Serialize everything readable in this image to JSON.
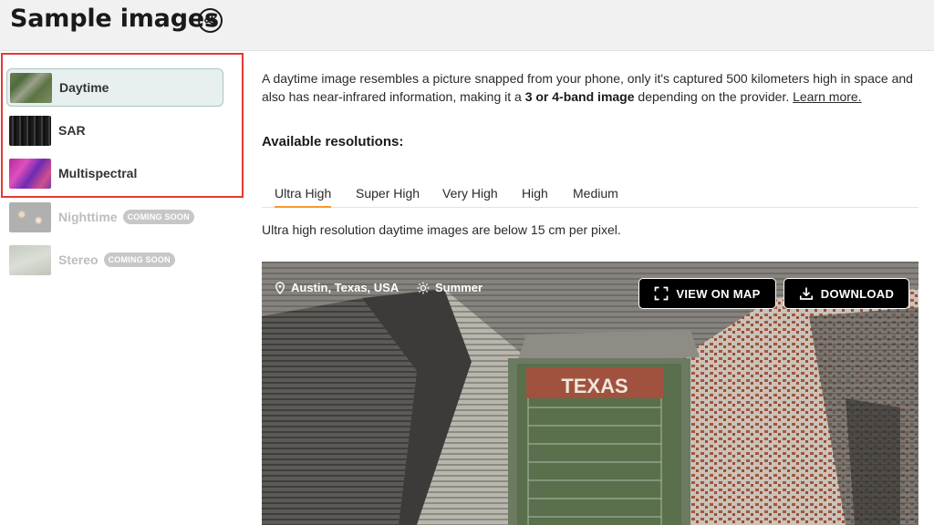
{
  "header": {
    "title": "Sample images",
    "share_icon": "share-icon"
  },
  "sidebar": {
    "items": [
      {
        "label": "Daytime",
        "badge": ""
      },
      {
        "label": "SAR",
        "badge": ""
      },
      {
        "label": "Multispectral",
        "badge": ""
      },
      {
        "label": "Nighttime",
        "badge": "COMING SOON"
      },
      {
        "label": "Stereo",
        "badge": "COMING SOON"
      }
    ]
  },
  "main": {
    "description_part1": "A daytime image resembles a picture snapped from your phone, only it's captured 500 kilometers high in space and also has near-infrared information, making it a ",
    "description_bold": "3 or 4-band image",
    "description_part2": " depending on the provider. ",
    "learn_more": "Learn more.",
    "resolutions_title": "Available resolutions:",
    "tabs": [
      "Ultra High",
      "Super High",
      "Very High",
      "High",
      "Medium"
    ],
    "active_tab": "Ultra High",
    "resolution_note": "Ultra high resolution daytime images are below 15 cm per pixel."
  },
  "viewer": {
    "location": "Austin, Texas, USA",
    "season": "Summer",
    "view_on_map": "VIEW ON MAP",
    "download": "DOWNLOAD",
    "image_text": "TEXAS"
  },
  "colors": {
    "accent_tab": "#f59b2d",
    "highlight_border": "#e53935",
    "active_item_bg": "#e8efef"
  }
}
